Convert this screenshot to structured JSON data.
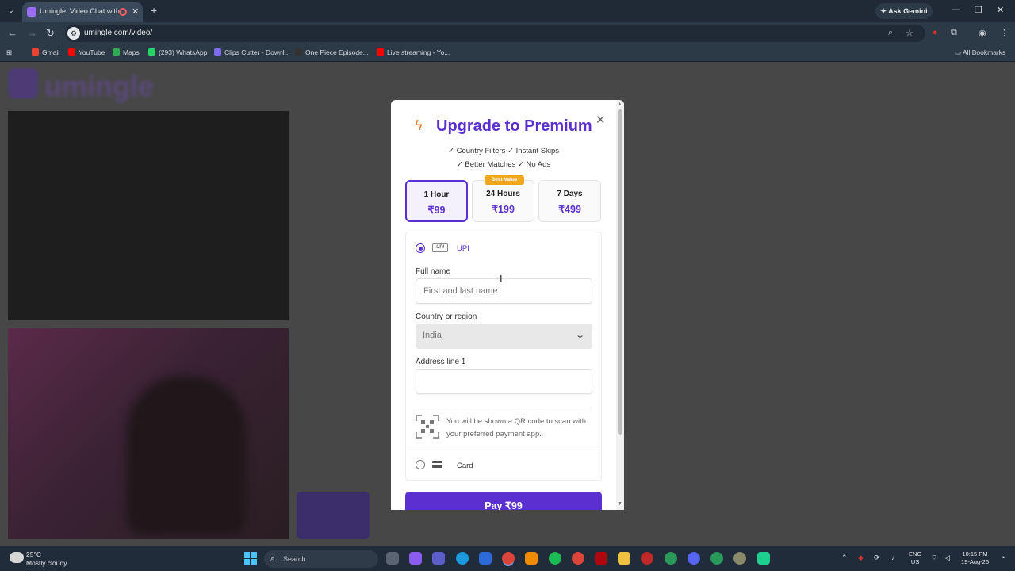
{
  "browser": {
    "tab_title": "Umingle: Video Chat with St",
    "url": "umingle.com/video/",
    "ask_gemini": "Ask Gemini",
    "bookmarks": [
      {
        "label": "Gmail",
        "color": "#ea4335"
      },
      {
        "label": "YouTube",
        "color": "#ff0000"
      },
      {
        "label": "Maps",
        "color": "#34a853"
      },
      {
        "label": "(293) WhatsApp",
        "color": "#25d366"
      },
      {
        "label": "Clips Cutter - Downl...",
        "color": "#7c6cf0"
      },
      {
        "label": "One Piece Episode...",
        "color": "#333333"
      },
      {
        "label": "Live streaming - Yo...",
        "color": "#ff0000"
      }
    ],
    "all_bookmarks": "All Bookmarks"
  },
  "page": {
    "logo": "umingle"
  },
  "modal": {
    "title": "Upgrade to Premium",
    "features_line1": "✓ Country Filters  ✓ Instant Skips",
    "features_line2": "✓ Better Matches  ✓ No Ads",
    "plans": [
      {
        "name": "1 Hour",
        "price": "₹99"
      },
      {
        "name": "24 Hours",
        "price": "₹199"
      },
      {
        "name": "7 Days",
        "price": "₹499"
      }
    ],
    "best_value": "Best Value",
    "payment": {
      "upi_label": "UPI",
      "upi_logo": "UPI",
      "full_name_label": "Full name",
      "full_name_placeholder": "First and last name",
      "country_label": "Country or region",
      "country_value": "India",
      "address_label": "Address line 1",
      "qr_text": "You will be shown a QR code to scan with your preferred payment app.",
      "card_label": "Card"
    },
    "pay_button": "Pay ₹99"
  },
  "taskbar": {
    "temp": "25°C",
    "weather": "Mostly cloudy",
    "search": "Search",
    "lang1": "ENG",
    "lang2": "US",
    "time": "10:15 PM",
    "date": "19-Aug-26"
  }
}
